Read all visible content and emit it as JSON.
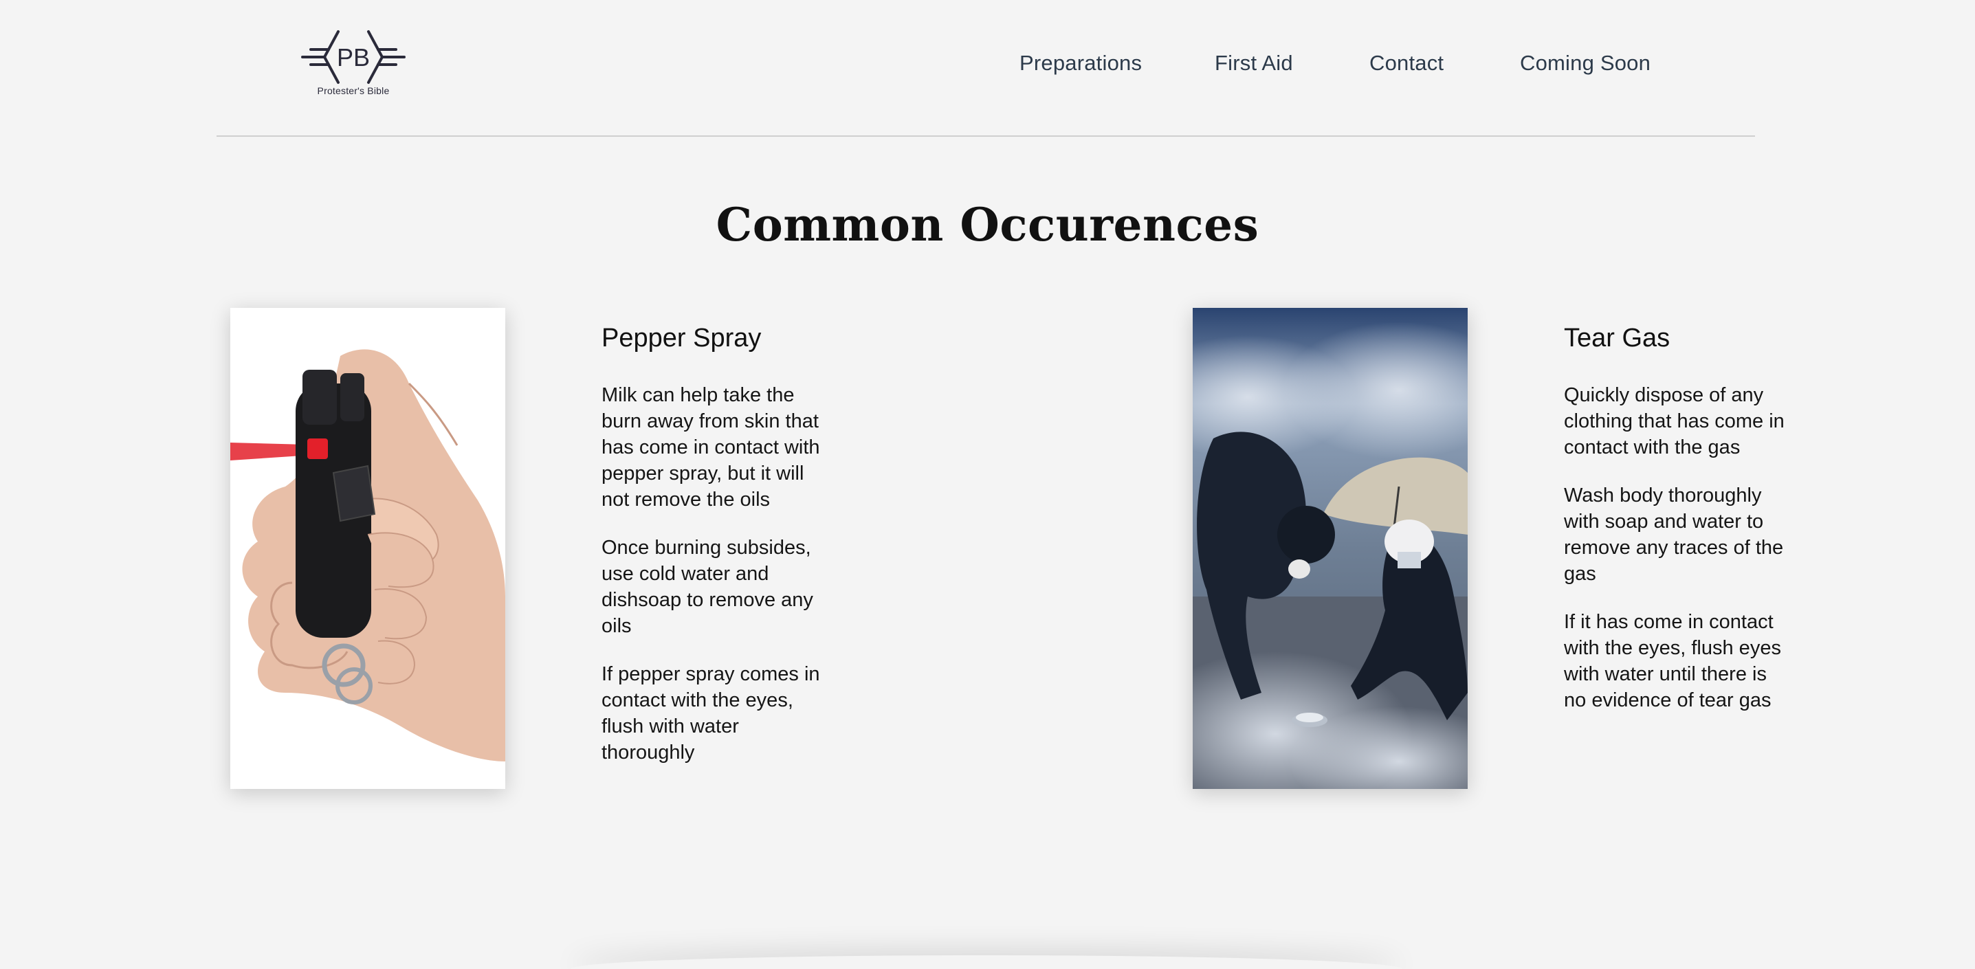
{
  "header": {
    "logo_letters": "PB",
    "logo_caption": "Protester's Bible",
    "nav": [
      "Preparations",
      "First Aid",
      "Contact",
      "Coming Soon"
    ]
  },
  "main": {
    "title": "Common Occurences",
    "cards": [
      {
        "image_icon": "pepper-spray-photo",
        "heading": "Pepper Spray",
        "paragraphs": [
          "Milk can help take the burn away from skin that has come in contact with pepper spray, but it will not remove the oils",
          "Once burning subsides, use cold water and dishsoap to remove any oils",
          "If pepper spray comes in contact with the eyes, flush with water thoroughly"
        ]
      },
      {
        "image_icon": "tear-gas-photo",
        "heading": "Tear Gas",
        "paragraphs": [
          "Quickly dispose of any clothing that has come in contact with the gas",
          "Wash body thoroughly with soap and water to remove any traces of the gas",
          "If it has come in contact with the eyes, flush eyes with water until there is no evidence of tear gas"
        ]
      }
    ]
  },
  "colors": {
    "background": "#f4f4f4",
    "nav_text": "#2c3a4a",
    "logo": "#2a2a3a",
    "spray_red": "#e3202a"
  }
}
